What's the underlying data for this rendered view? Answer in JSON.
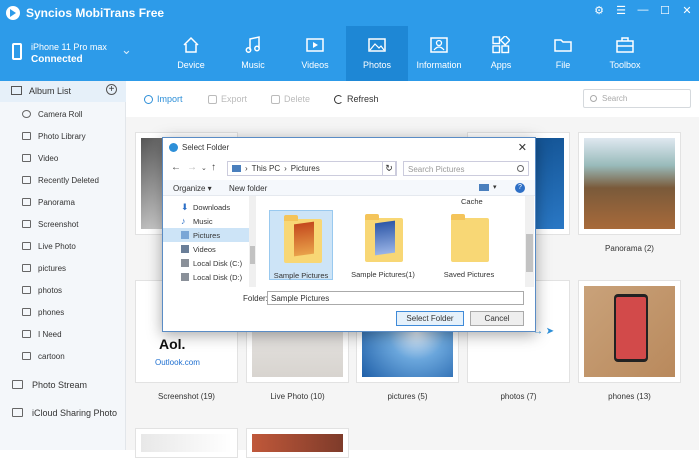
{
  "app": {
    "title": "Syncios MobiTrans Free"
  },
  "window_controls": [
    "⚙",
    "☰",
    "—",
    "☐",
    "✕"
  ],
  "device": {
    "name": "iPhone 11 Pro max",
    "status": "Connected"
  },
  "tabs": [
    {
      "label": "Device",
      "icon": "home-icon"
    },
    {
      "label": "Music",
      "icon": "music-icon"
    },
    {
      "label": "Videos",
      "icon": "video-icon"
    },
    {
      "label": "Photos",
      "icon": "photo-icon",
      "active": true
    },
    {
      "label": "Information",
      "icon": "contact-card-icon"
    },
    {
      "label": "Apps",
      "icon": "apps-icon"
    },
    {
      "label": "File",
      "icon": "folder-icon"
    },
    {
      "label": "Toolbox",
      "icon": "toolbox-icon"
    }
  ],
  "sidebar": {
    "album_list": "Album List",
    "items": [
      "Camera Roll",
      "Photo Library",
      "Video",
      "Recently Deleted",
      "Panorama",
      "Screenshot",
      "Live Photo",
      "pictures",
      "photos",
      "phones",
      "I Need",
      "cartoon"
    ],
    "photo_stream": "Photo Stream",
    "icloud_sharing": "iCloud Sharing Photo"
  },
  "toolbar": {
    "import": "Import",
    "export": "Export",
    "delete": "Delete",
    "refresh": "Refresh",
    "search_placeholder": "Search"
  },
  "grid": {
    "row1_captions": [
      "C",
      "",
      "",
      "ed (51)",
      "Panorama (2)"
    ],
    "row2_captions": [
      "Screenshot (19)",
      "Live Photo (10)",
      "pictures (5)",
      "photos (7)",
      "phones (13)"
    ],
    "aol_text": "Aol.",
    "outlook_text": "Outlook.com"
  },
  "dialog": {
    "title": "Select Folder",
    "address": [
      "This PC",
      "Pictures"
    ],
    "search_placeholder": "Search Pictures",
    "organize": "Organize ▾",
    "new_folder": "New folder",
    "tree": [
      "Downloads",
      "Music",
      "Pictures",
      "Videos",
      "Local Disk (C:)",
      "Local Disk (D:)"
    ],
    "cache_label": "Cache",
    "files": [
      "Sample Pictures",
      "Sample Pictures(1)",
      "Saved Pictures"
    ],
    "folder_label": "Folder:",
    "folder_value": "Sample Pictures",
    "select_button": "Select Folder",
    "cancel_button": "Cancel"
  },
  "colors": {
    "header": "#2d9be9",
    "active_tab": "#1e87d5",
    "accent": "#2d8fd8"
  }
}
